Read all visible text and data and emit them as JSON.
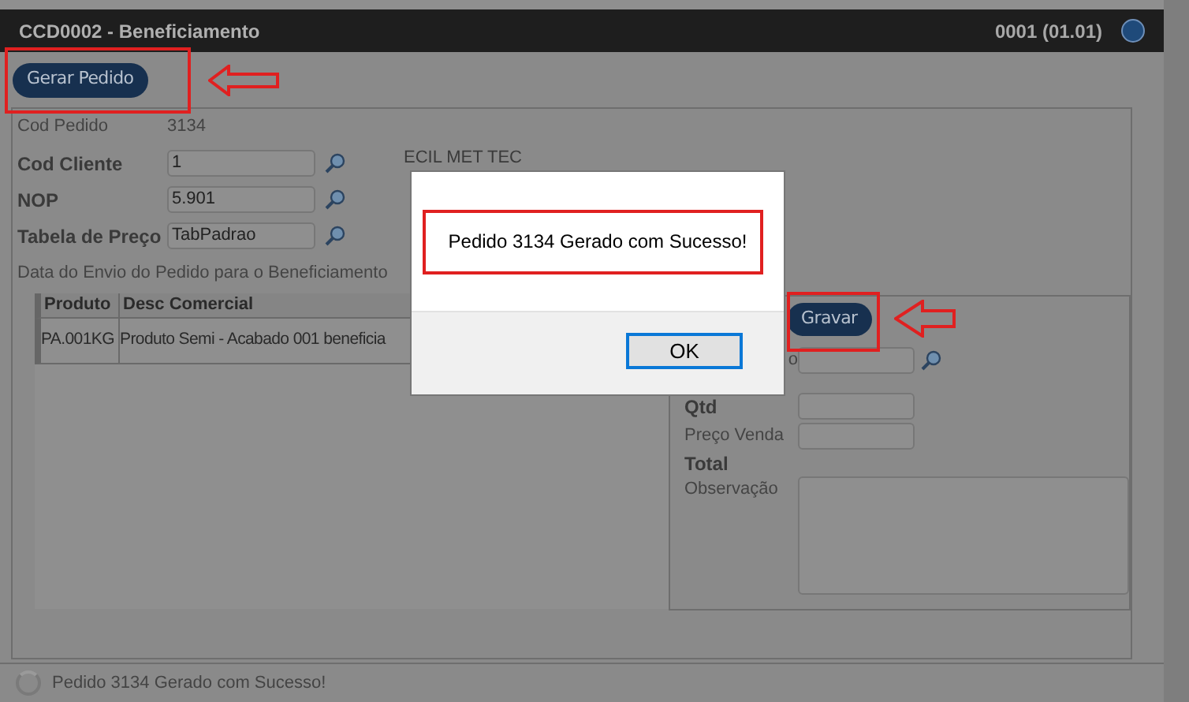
{
  "window": {
    "title": "CCD0002 - Beneficiamento",
    "company": "0001 (01.01)"
  },
  "toolbar": {
    "button": "Gerar Pedido"
  },
  "form": {
    "fields": [
      {
        "label": "Cod Pedido",
        "value": "3134",
        "kind": "text",
        "strong": false
      },
      {
        "label": "Cod Cliente",
        "value": "1",
        "kind": "lookup",
        "strong": true,
        "description": "ECIL MET TEC"
      },
      {
        "label": "NOP",
        "value": "5.901",
        "kind": "lookup",
        "strong": true
      },
      {
        "label": "Tabela de Preço",
        "value": "TabPadrao",
        "kind": "lookup",
        "strong": true
      }
    ],
    "note": "Data do Envio do Pedido para o Beneficiamento"
  },
  "items_table": {
    "columns": [
      "Produto",
      "Desc Comercial"
    ],
    "rows": [
      [
        "PA.001KG",
        "Produto Semi - Acabado 001 beneficia"
      ]
    ]
  },
  "item_form": {
    "button": "Gravar",
    "fields": [
      {
        "label": "o",
        "kind": "lookup",
        "strong": false
      },
      {
        "label": "Qtd",
        "kind": "input",
        "strong": true
      },
      {
        "label": "Preço Venda",
        "kind": "input",
        "strong": false
      },
      {
        "label": "Total",
        "kind": "text",
        "strong": true
      },
      {
        "label": "Observação",
        "kind": "textarea",
        "strong": false
      }
    ]
  },
  "dialog": {
    "message": "Pedido 3134 Gerado com Sucesso!",
    "button": "OK"
  },
  "status_bar": {
    "message": "Pedido 3134 Gerado com Sucesso!"
  }
}
